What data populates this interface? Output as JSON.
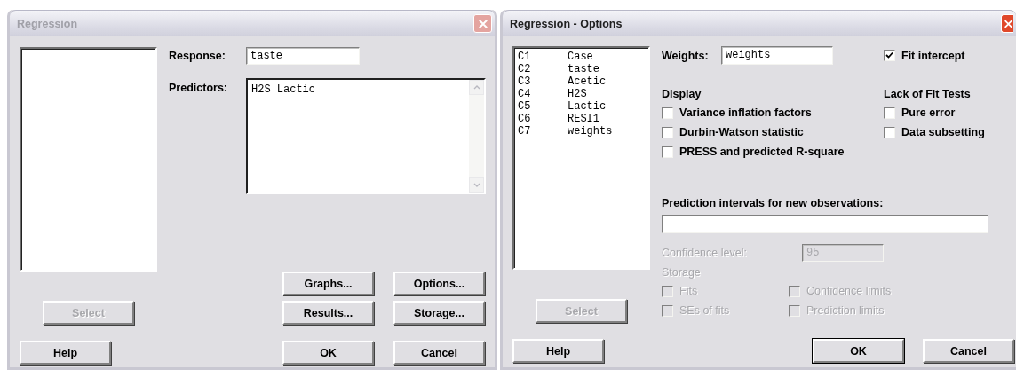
{
  "regression_dialog": {
    "title": "Regression",
    "active": false,
    "response": {
      "label": "Response:",
      "value": "taste"
    },
    "predictors": {
      "label": "Predictors:",
      "value": "H2S Lactic"
    },
    "select_button": {
      "label": "Select",
      "disabled": true
    },
    "action_buttons": [
      {
        "label": "Graphs..."
      },
      {
        "label": "Options..."
      },
      {
        "label": "Results..."
      },
      {
        "label": "Storage..."
      }
    ],
    "help_button": {
      "label": "Help"
    },
    "ok_button": {
      "label": "OK",
      "default": false
    },
    "cancel_button": {
      "label": "Cancel"
    }
  },
  "options_dialog": {
    "title": "Regression - Options",
    "active": true,
    "columns": [
      {
        "number": "C1",
        "name": "Case"
      },
      {
        "number": "C2",
        "name": "taste"
      },
      {
        "number": "C3",
        "name": "Acetic"
      },
      {
        "number": "C4",
        "name": "H2S"
      },
      {
        "number": "C5",
        "name": "Lactic"
      },
      {
        "number": "C6",
        "name": "RESI1"
      },
      {
        "number": "C7",
        "name": "weights"
      }
    ],
    "weights": {
      "label": "Weights:",
      "value": "weights"
    },
    "fit_intercept": {
      "label": "Fit intercept",
      "checked": true
    },
    "display": {
      "heading": "Display",
      "options": [
        {
          "label": "Variance inflation factors",
          "checked": false
        },
        {
          "label": "Durbin-Watson statistic",
          "checked": false
        },
        {
          "label": "PRESS and predicted R-square",
          "checked": false
        }
      ]
    },
    "lack_of_fit": {
      "heading": "Lack of Fit Tests",
      "options": [
        {
          "label": "Pure error",
          "checked": false
        },
        {
          "label": "Data subsetting",
          "checked": false
        }
      ]
    },
    "prediction": {
      "label": "Prediction intervals for new observations:"
    },
    "confidence": {
      "label": "Confidence level:",
      "value": "95",
      "disabled": true
    },
    "storage": {
      "heading": "Storage",
      "disabled": true,
      "options": [
        {
          "label": "Fits",
          "checked": false
        },
        {
          "label": "Confidence limits",
          "checked": false
        },
        {
          "label": "SEs of fits",
          "checked": false
        },
        {
          "label": "Prediction limits",
          "checked": false
        }
      ]
    },
    "select_button": {
      "label": "Select",
      "disabled": true
    },
    "help_button": {
      "label": "Help"
    },
    "ok_button": {
      "label": "OK",
      "default": true
    },
    "cancel_button": {
      "label": "Cancel"
    }
  }
}
